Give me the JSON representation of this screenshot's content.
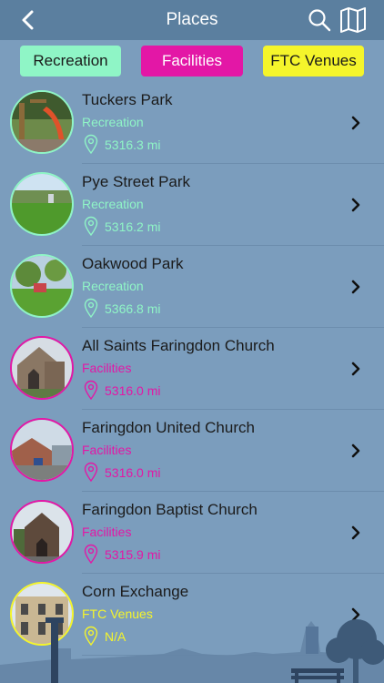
{
  "nav": {
    "title": "Places",
    "back_icon": "chevron-left-icon",
    "search_icon": "search-icon",
    "map_icon": "map-icon"
  },
  "filters": [
    {
      "label": "Recreation",
      "color": "#8ff5c6"
    },
    {
      "label": "Facilities",
      "color": "#e317a6"
    },
    {
      "label": "FTC Venues",
      "color": "#f5f52b"
    }
  ],
  "places": [
    {
      "name": "Tuckers Park",
      "category": "Recreation",
      "distance": "5316.3 mi",
      "accent": "#8ff5c6",
      "image": "playground-photo"
    },
    {
      "name": "Pye Street Park",
      "category": "Recreation",
      "distance": "5316.2 mi",
      "accent": "#8ff5c6",
      "image": "park-lawn-photo"
    },
    {
      "name": "Oakwood Park",
      "category": "Recreation",
      "distance": "5366.8 mi",
      "accent": "#8ff5c6",
      "image": "park-trees-photo"
    },
    {
      "name": "All Saints Faringdon Church",
      "category": "Facilities",
      "distance": "5316.0 mi",
      "accent": "#e317a6",
      "image": "stone-church-photo"
    },
    {
      "name": "Faringdon United Church",
      "category": "Facilities",
      "distance": "5316.0 mi",
      "accent": "#e317a6",
      "image": "church-street-photo"
    },
    {
      "name": "Faringdon Baptist Church",
      "category": "Facilities",
      "distance": "5315.9 mi",
      "accent": "#e317a6",
      "image": "baptist-church-photo"
    },
    {
      "name": "Corn Exchange",
      "category": "FTC Venues",
      "distance": "N/A",
      "accent": "#f5f52b",
      "image": "corn-exchange-photo"
    }
  ]
}
